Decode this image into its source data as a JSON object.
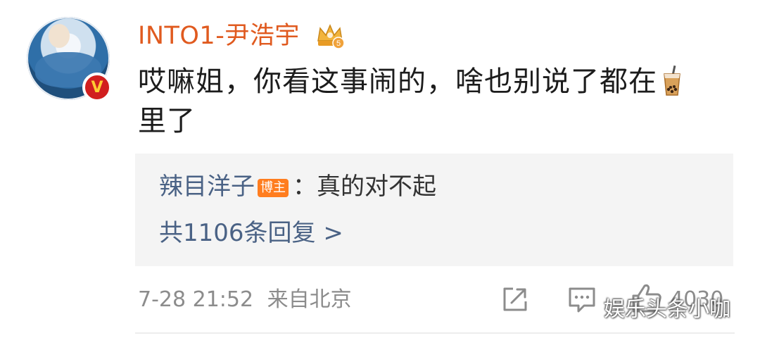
{
  "post": {
    "author": "INTO1-尹浩宇",
    "author_crown_level": "5",
    "verified_mark": "V",
    "comment_line1": "哎嘛姐，你看这事闹的，啥也别说了都在",
    "comment_line2": "里了",
    "comment_emoji": "bubble-tea-icon"
  },
  "reply": {
    "author": "辣目洋子",
    "badge": "博主",
    "separator": "：",
    "text": "真的对不起",
    "count_label": "共1106条回复 >"
  },
  "meta": {
    "timestamp": "7-28 21:52",
    "location": "来自北京",
    "like_count": "4030"
  },
  "watermark": "娱乐头条小咖",
  "colors": {
    "username": "#e05a1f",
    "link": "#4a6285",
    "badge": "#ff7d1f",
    "verified": "#d11f1f"
  }
}
